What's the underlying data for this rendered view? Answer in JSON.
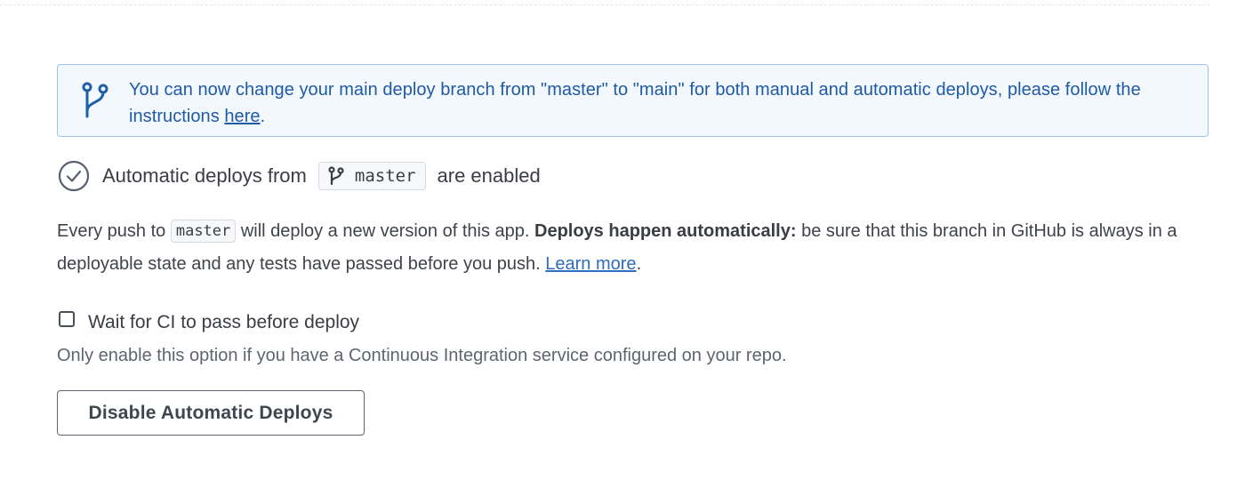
{
  "notice": {
    "icon": "git-branch-icon",
    "text_before": "You can now change your main deploy branch from \"master\" to \"main\" for both manual and automatic deploys, please follow the instructions ",
    "link_label": "here",
    "text_after": ".",
    "color": "#1f5aa6"
  },
  "status": {
    "icon": "check-circle-icon",
    "text_before": "Automatic deploys from",
    "branch": "master",
    "text_after": "are enabled"
  },
  "description": {
    "part1": "Every push to ",
    "code": "master",
    "part2": " will deploy a new version of this app. ",
    "bold": "Deploys happen automatically:",
    "part3": " be sure that this branch in GitHub is always in a deployable state and any tests have passed before you push. ",
    "link_label": "Learn more",
    "part4": "."
  },
  "ci": {
    "checkbox_label": "Wait for CI to pass before deploy",
    "checked": false,
    "help_text": "Only enable this option if you have a Continuous Integration service configured on your repo."
  },
  "actions": {
    "disable_label": "Disable Automatic Deploys"
  }
}
